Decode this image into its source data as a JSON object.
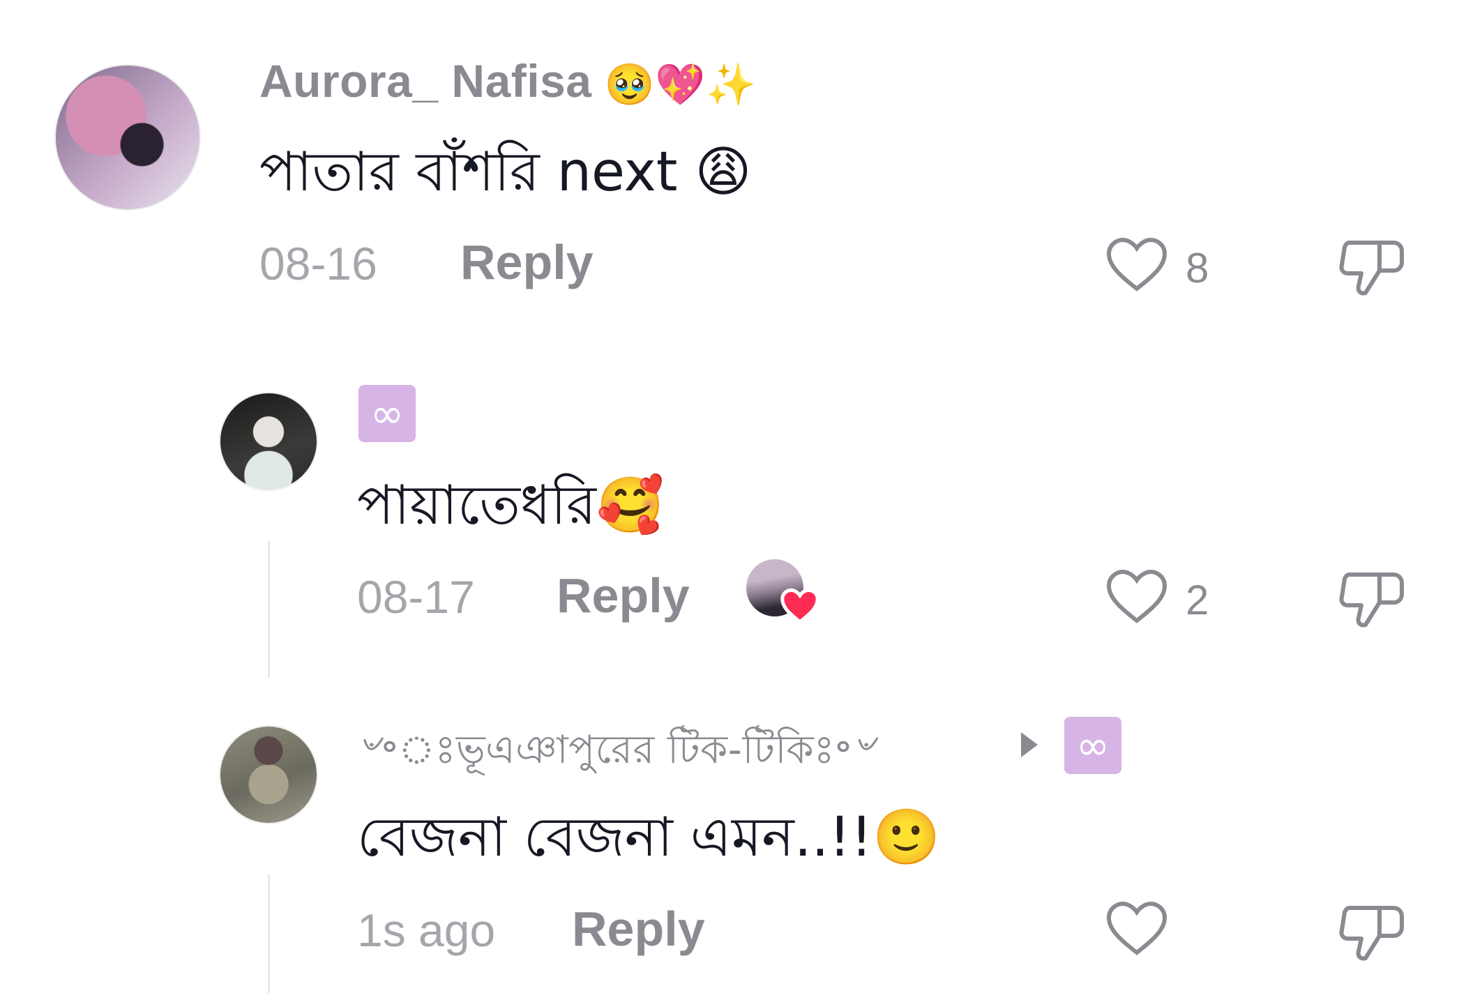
{
  "comments": [
    {
      "username": "Aurora_ Nafisa",
      "username_emojis": "🥹💖✨",
      "text": "পাতার বাঁশরি next",
      "text_emoji": "😩",
      "date": "08-16",
      "reply_label": "Reply",
      "likes": "8"
    },
    {
      "badge_glyph": "∞",
      "text": "পায়াতেধরি",
      "text_emoji": "🥰",
      "date": "08-17",
      "reply_label": "Reply",
      "likes": "2"
    },
    {
      "username": "৺॰ঃভূএঞাপুরের টিক-টিকিঃ॰৺",
      "badge_glyph": "∞",
      "text": "বেজনা বেজনা এমন..!!",
      "text_emoji": "🙂",
      "date": "1s ago",
      "reply_label": "Reply"
    }
  ],
  "colors": {
    "text_primary": "#161823",
    "text_secondary": "#8a8b91",
    "badge_bg": "#d6b4e6",
    "heart_red": "#fe2c55"
  }
}
